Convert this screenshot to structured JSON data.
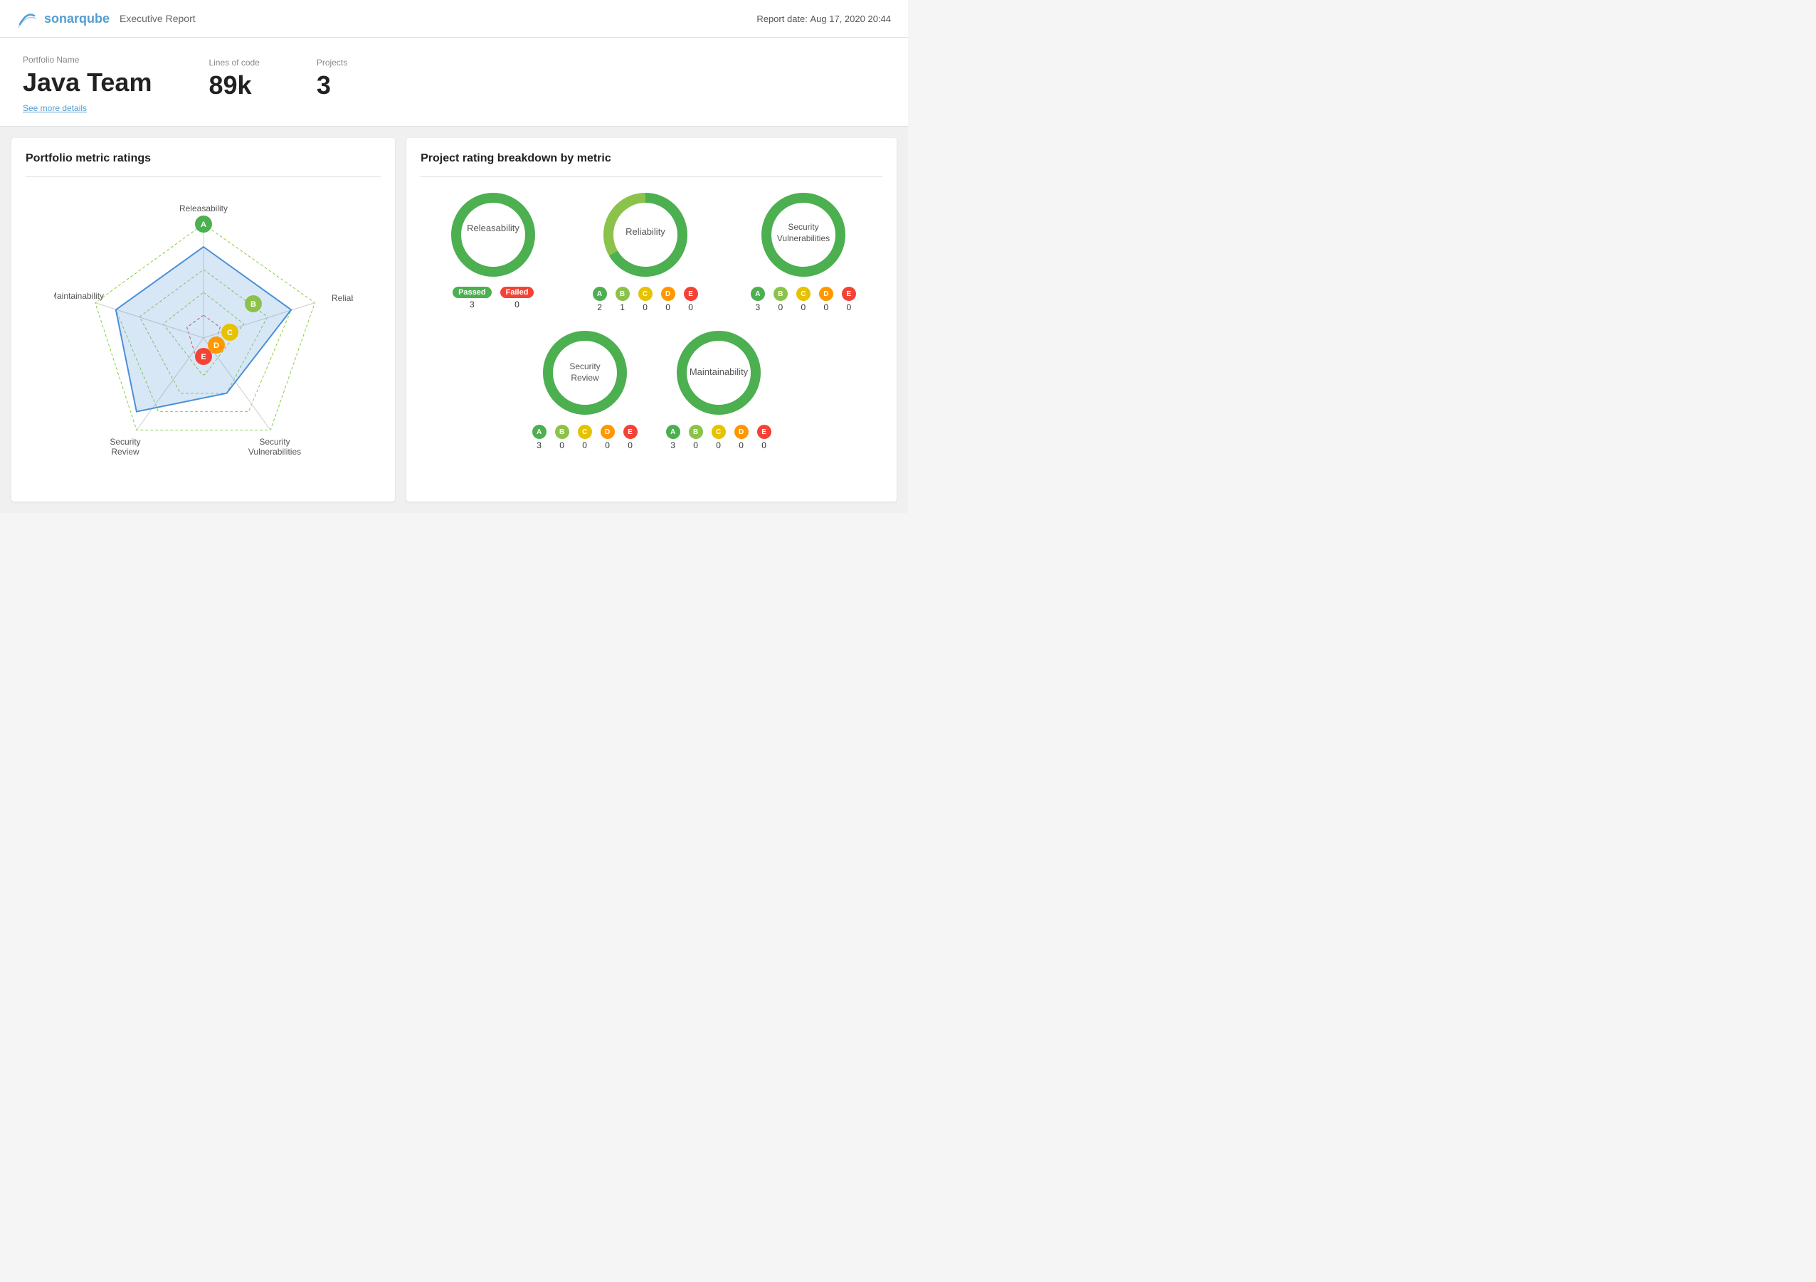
{
  "header": {
    "logo": "SonarQube",
    "report_type": "Executive Report",
    "report_date_label": "Report date:",
    "report_date": "Aug 17, 2020 20:44"
  },
  "portfolio": {
    "name_label": "Portfolio Name",
    "name": "Java Team",
    "see_more": "See more details",
    "lines_of_code_label": "Lines of code",
    "lines_of_code": "89k",
    "projects_label": "Projects",
    "projects": "3"
  },
  "left_card": {
    "title": "Portfolio metric ratings",
    "axes": [
      "Maintainability",
      "Releasability",
      "Reliability",
      "Security Vulnerabilities",
      "Security Review"
    ],
    "ratings": [
      "A",
      "B",
      "C",
      "D",
      "E"
    ],
    "rating_colors": {
      "A": "#4caf50",
      "B": "#8bc34a",
      "C": "#ffeb3b",
      "D": "#ff9800",
      "E": "#f44336"
    }
  },
  "right_card": {
    "title": "Project rating breakdown by metric",
    "donuts": [
      {
        "id": "releasability",
        "label": "Releasability",
        "segments": [
          {
            "value": 3,
            "color": "#4caf50"
          },
          {
            "value": 0,
            "color": "#f44336"
          }
        ],
        "legend_type": "passed_failed",
        "passed": 3,
        "failed": 0
      },
      {
        "id": "reliability",
        "label": "Reliability",
        "segments": [
          {
            "value": 2,
            "color": "#4caf50"
          },
          {
            "value": 1,
            "color": "#8bc34a"
          },
          {
            "value": 0,
            "color": "#ffeb3b"
          },
          {
            "value": 0,
            "color": "#ff9800"
          },
          {
            "value": 0,
            "color": "#f44336"
          }
        ],
        "legend_type": "abcde",
        "counts": [
          2,
          1,
          0,
          0,
          0
        ]
      },
      {
        "id": "security-vulnerabilities",
        "label": "Security Vulnerabilities",
        "segments": [
          {
            "value": 3,
            "color": "#4caf50"
          },
          {
            "value": 0,
            "color": "#8bc34a"
          },
          {
            "value": 0,
            "color": "#ffeb3b"
          },
          {
            "value": 0,
            "color": "#ff9800"
          },
          {
            "value": 0,
            "color": "#f44336"
          }
        ],
        "legend_type": "abcde",
        "counts": [
          3,
          0,
          0,
          0,
          0
        ]
      },
      {
        "id": "security-review",
        "label": "Security Review",
        "segments": [
          {
            "value": 3,
            "color": "#4caf50"
          },
          {
            "value": 0,
            "color": "#8bc34a"
          },
          {
            "value": 0,
            "color": "#ffeb3b"
          },
          {
            "value": 0,
            "color": "#ff9800"
          },
          {
            "value": 0,
            "color": "#f44336"
          }
        ],
        "legend_type": "abcde",
        "counts": [
          3,
          0,
          0,
          0,
          0
        ]
      },
      {
        "id": "maintainability",
        "label": "Maintainability",
        "segments": [
          {
            "value": 3,
            "color": "#4caf50"
          },
          {
            "value": 0,
            "color": "#8bc34a"
          },
          {
            "value": 0,
            "color": "#ffeb3b"
          },
          {
            "value": 0,
            "color": "#ff9800"
          },
          {
            "value": 0,
            "color": "#f44336"
          }
        ],
        "legend_type": "abcde",
        "counts": [
          3,
          0,
          0,
          0,
          0
        ]
      }
    ],
    "grade_labels": [
      "A",
      "B",
      "C",
      "D",
      "E"
    ],
    "grade_colors": [
      "#4caf50",
      "#8bc34a",
      "#ffeb3b",
      "#ff9800",
      "#f44336"
    ],
    "passed_label": "Passed",
    "failed_label": "Failed"
  }
}
